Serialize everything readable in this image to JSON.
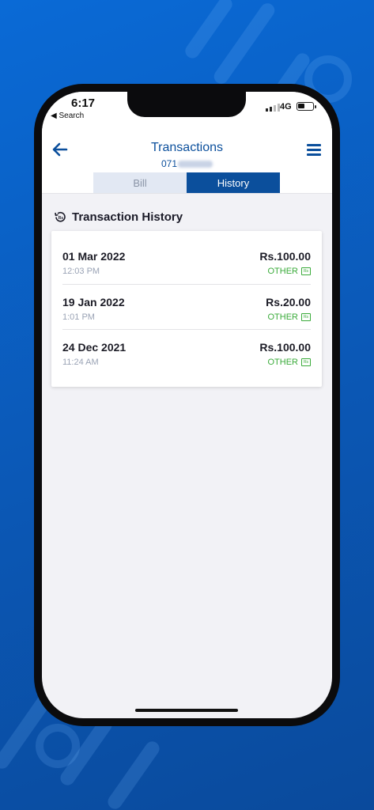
{
  "status_bar": {
    "time": "6:17",
    "back_label": "◀ Search",
    "network": "4G"
  },
  "header": {
    "title": "Transactions",
    "subtitle_prefix": "071",
    "tabs": [
      {
        "label": "Bill",
        "active": false
      },
      {
        "label": "History",
        "active": true
      }
    ]
  },
  "section": {
    "title": "Transaction History"
  },
  "transactions": [
    {
      "date": "01 Mar 2022",
      "time": "12:03 PM",
      "amount": "Rs.100.00",
      "type": "OTHER"
    },
    {
      "date": "19 Jan 2022",
      "time": "1:01 PM",
      "amount": "Rs.20.00",
      "type": "OTHER"
    },
    {
      "date": "24 Dec 2021",
      "time": "11:24 AM",
      "amount": "Rs.100.00",
      "type": "OTHER"
    }
  ],
  "colors": {
    "primary": "#0b4f9c",
    "success": "#3aab3a",
    "background": "#f2f2f6"
  }
}
